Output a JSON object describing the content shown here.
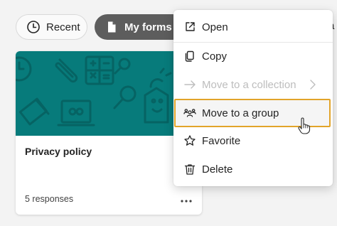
{
  "filters": {
    "recent_label": "Recent",
    "my_forms_label": "My forms",
    "next_chip_partial": "a"
  },
  "card": {
    "title": "Privacy policy",
    "responses": "5 responses",
    "banner_color": "#077b7b"
  },
  "context_menu": {
    "items": [
      {
        "label": "Open",
        "icon": "open-external-icon"
      },
      {
        "label": "Copy",
        "icon": "copy-icon"
      },
      {
        "label": "Move to a collection",
        "icon": "arrow-right-icon",
        "disabled": true
      },
      {
        "label": "Move to a group",
        "icon": "people-group-icon",
        "highlighted": true
      },
      {
        "label": "Favorite",
        "icon": "star-icon"
      },
      {
        "label": "Delete",
        "icon": "trash-icon"
      }
    ],
    "highlight_color": "#e2a429"
  }
}
